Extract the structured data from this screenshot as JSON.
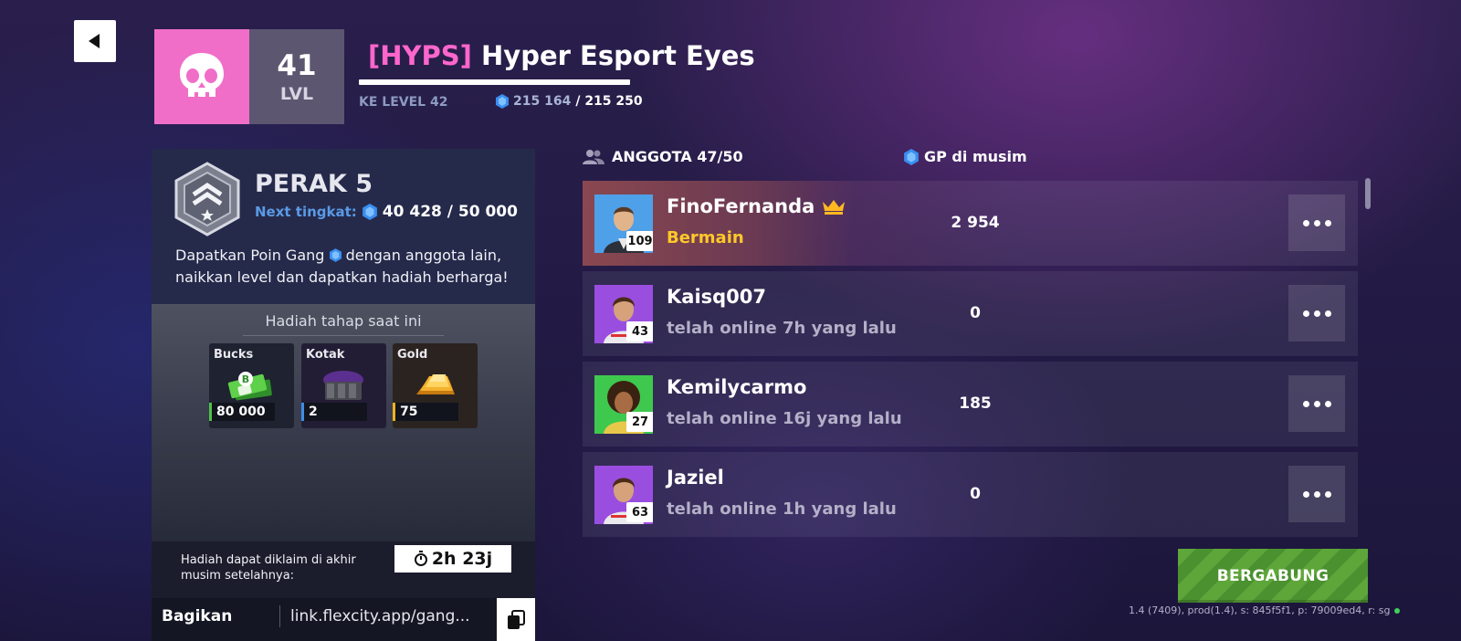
{
  "header": {
    "gang_tag": "[HYPS]",
    "gang_name": " Hyper Esport Eyes",
    "level": "41",
    "level_label": "LVL",
    "next_level_label": "KE LEVEL 42",
    "xp_current": "215 164",
    "xp_total": "/ 215 250",
    "xp_progress": 0.9996,
    "emblem_icon": "skull-icon",
    "emblem_color": "#f06ec8"
  },
  "rank": {
    "title": "PERAK 5",
    "next_label": "Next tingkat:",
    "progress": "40 428 / 50 000",
    "desc_part1": "Dapatkan Poin Gang ",
    "desc_part2": " dengan anggota lain, naikkan level dan dapatkan hadiah berharga!"
  },
  "rewards": {
    "title": "Hadiah tahap saat ini",
    "items": [
      {
        "label": "Bucks",
        "value": "80 000",
        "accent": "#4cc24a"
      },
      {
        "label": "Kotak",
        "value": "2",
        "accent": "#3d8ee8"
      },
      {
        "label": "Gold",
        "value": "75",
        "accent": "#f0b020"
      }
    ]
  },
  "claim": {
    "text": "Hadiah dapat diklaim di akhir musim setelahnya:",
    "timer": "2h 23j"
  },
  "share": {
    "label": "Bagikan",
    "link": "link.flexcity.app/gang..."
  },
  "members": {
    "header_label": "ANGGOTA 47/50",
    "gp_label": "GP di musim",
    "rows": [
      {
        "name": "FinoFernanda",
        "status": "Bermain",
        "gp": "2 954",
        "level": "109",
        "leader": true
      },
      {
        "name": "Kaisq007",
        "status": "telah online 7h yang lalu",
        "gp": "0",
        "level": "43",
        "leader": false
      },
      {
        "name": "Kemilycarmo",
        "status": "telah online 16j yang lalu",
        "gp": "185",
        "level": "27",
        "leader": false
      },
      {
        "name": "Jaziel",
        "status": "telah online 1h yang lalu",
        "gp": "0",
        "level": "63",
        "leader": false
      }
    ]
  },
  "join_button": "BERGABUNG",
  "build_info": "1.4 (7409), prod(1.4), s: 845f5f1, p: 79009ed4, r: sg"
}
